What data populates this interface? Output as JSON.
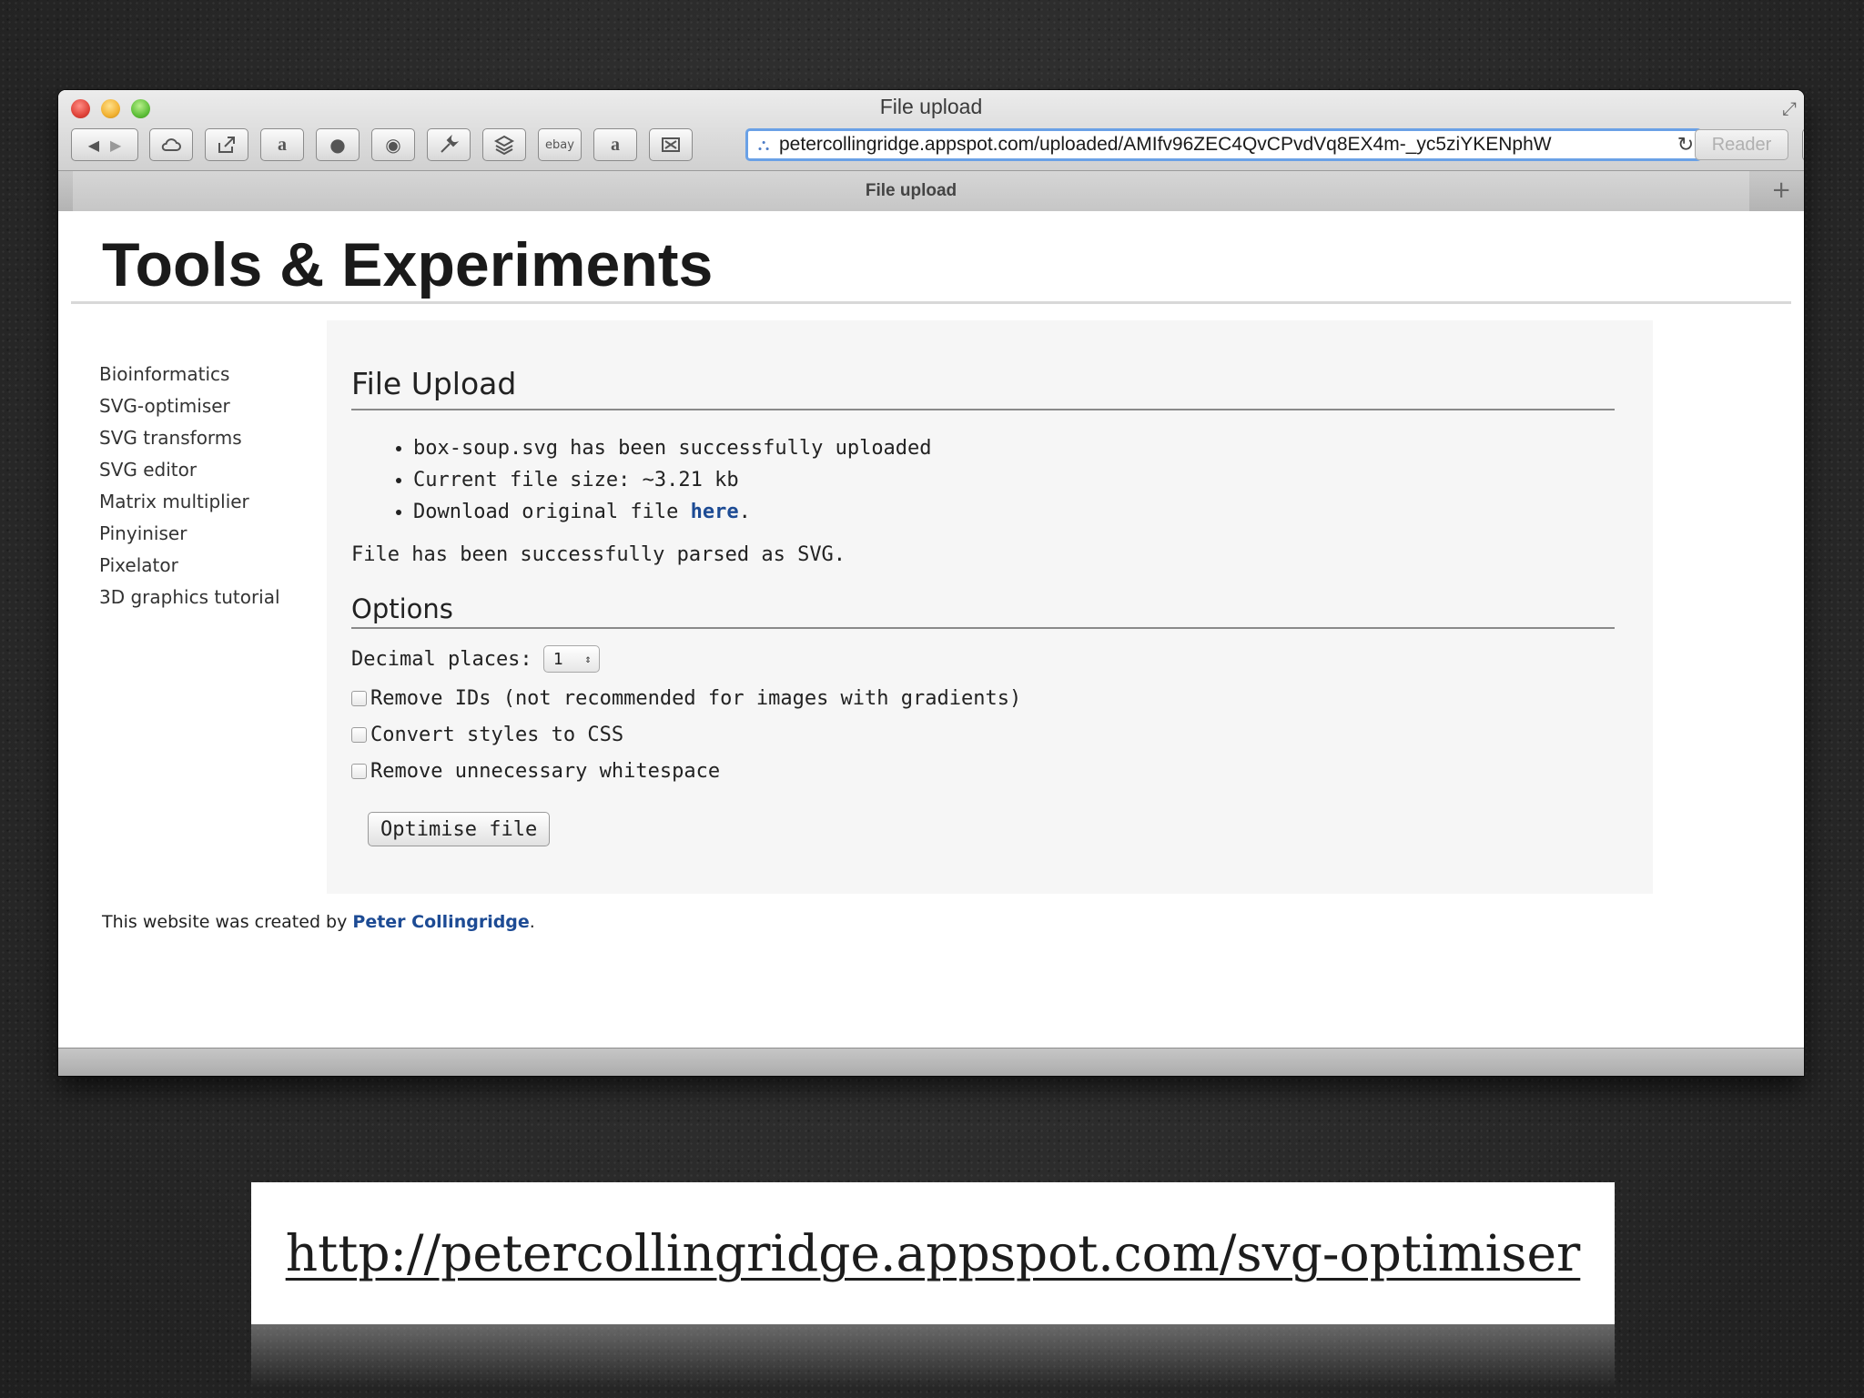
{
  "window": {
    "title": "File upload",
    "tab_label": "File upload",
    "url": "petercollingridge.appspot.com/uploaded/AMIfv96ZEC4QvCPvdVq8EX4m-_yc5ziYKENphW",
    "reader_label": "Reader",
    "toolbar_icons": [
      "back-icon",
      "forward-icon",
      "icloud-icon",
      "share-icon",
      "amazon-icon",
      "bookmarklet-icon",
      "bookmarklet-icon",
      "wrench-icon",
      "layers-icon",
      "ebay-icon",
      "amazon-icon",
      "clip-icon"
    ],
    "ebay_label": "ebay",
    "new_tab_symbol": "+",
    "reload_symbol": "↻"
  },
  "site": {
    "title": "Tools & Experiments",
    "nav": [
      "Bioinformatics",
      "SVG-optimiser",
      "SVG transforms",
      "SVG editor",
      "Matrix multiplier",
      "Pinyiniser",
      "Pixelator",
      "3D graphics tutorial"
    ]
  },
  "upload": {
    "heading": "File Upload",
    "item1": "box-soup.svg has been successfully uploaded",
    "item2": "Current file size: ~3.21 kb",
    "item3_prefix": "Download original file ",
    "item3_link": "here",
    "item3_suffix": ".",
    "parsed_message": "File has been successfully parsed as SVG."
  },
  "options": {
    "heading": "Options",
    "decimal_label": "Decimal places:",
    "decimal_value": "1",
    "checkboxes": [
      {
        "label": "Remove IDs (not recommended for images with gradients)",
        "checked": false
      },
      {
        "label": "Convert styles to CSS",
        "checked": false
      },
      {
        "label": "Remove unnecessary whitespace",
        "checked": false
      }
    ],
    "button_label": "Optimise file"
  },
  "footer": {
    "prefix": "This website was created by ",
    "author": "Peter Collingridge",
    "suffix": "."
  },
  "caption": {
    "link": "http://petercollingridge.appspot.com/svg-optimiser"
  },
  "colors": {
    "link": "#1d4b94",
    "url_focus": "#6aa1e6"
  }
}
